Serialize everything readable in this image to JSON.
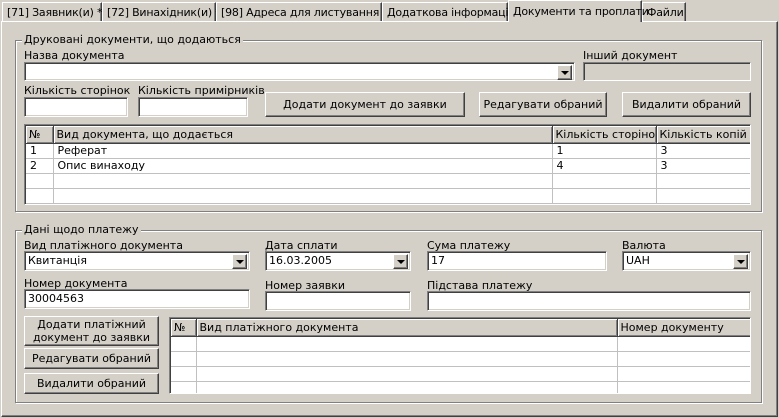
{
  "tabs": [
    {
      "label": "[71] Заявник(и) *"
    },
    {
      "label": "[72] Винахідник(и) *"
    },
    {
      "label": "[98] Адреса для листування *"
    },
    {
      "label": "Додаткова інформація"
    },
    {
      "label": "Документи та проплати"
    },
    {
      "label": "Файли"
    }
  ],
  "docs": {
    "title": "Друковані документи, що додаються",
    "doc_name_label": "Назва документа",
    "doc_name_value": "",
    "other_doc_label": "Інший документ",
    "pages_label": "Кількість сторінок",
    "copies_label": "Кількість примірників",
    "add_button": "Додати документ до заявки",
    "edit_button": "Редагувати обраний",
    "delete_button": "Видалити обраний",
    "table": {
      "columns": [
        "№",
        "Вид документа, що додається",
        "Кількість сторінок",
        "Кількість копій"
      ],
      "rows": [
        [
          "1",
          "Реферат",
          "1",
          "3"
        ],
        [
          "2",
          "Опис винаходу",
          "4",
          "3"
        ]
      ]
    }
  },
  "payment": {
    "title": "Дані щодо платежу",
    "doc_type_label": "Вид платіжного документа",
    "doc_type_value": "Квитанція",
    "date_label": "Дата сплати",
    "date_value": "16.03.2005",
    "sum_label": "Сума платежу",
    "sum_value": "17",
    "currency_label": "Валюта",
    "currency_value": "UAH",
    "doc_number_label": "Номер документа",
    "doc_number_value": "30004563",
    "app_number_label": "Номер заявки",
    "app_number_value": "",
    "basis_label": "Підстава платежу",
    "basis_value": "",
    "add_button": "Додати платіжний документ до заявки",
    "edit_button": "Редагувати обраний",
    "delete_button": "Видалити обраний",
    "table": {
      "columns": [
        "№",
        "Вид платіжного документа",
        "Номер документу"
      ],
      "rows": []
    }
  }
}
